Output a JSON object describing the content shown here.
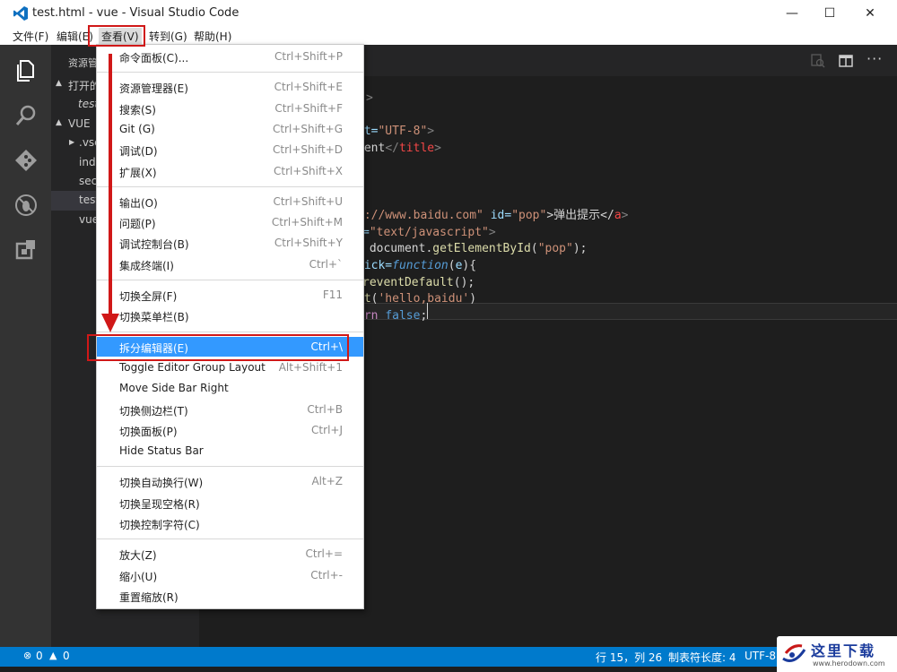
{
  "window": {
    "title": "test.html - vue - Visual Studio Code",
    "minimize": "—",
    "maximize": "☐",
    "close": "✕"
  },
  "menubar": {
    "items": [
      "文件(F)",
      "编辑(E)",
      "查看(V)",
      "转到(G)",
      "帮助(H)"
    ]
  },
  "sidebar": {
    "header": "资源管",
    "sections": [
      {
        "label": "打开的",
        "arrow": "▲"
      },
      {
        "label": "VUE",
        "arrow": "▲"
      }
    ],
    "open_file": "test",
    "files": [
      {
        "name": ".vsc",
        "arrow": "▶"
      },
      {
        "name": "inde"
      },
      {
        "name": "sect"
      },
      {
        "name": "test"
      },
      {
        "name": "vue"
      }
    ]
  },
  "code_lines": [
    {
      "parts": [
        {
          "t": ">",
          "c": "#808080"
        }
      ]
    },
    {
      "parts": []
    },
    {
      "parts": [
        {
          "t": "et=",
          "c": "#9cdcfe"
        },
        {
          "t": "\"UTF-8\"",
          "c": "#ce9178"
        },
        {
          "t": ">",
          "c": "#808080"
        }
      ]
    },
    {
      "parts": [
        {
          "t": "ment",
          "c": "#d4d4d4"
        },
        {
          "t": "</",
          "c": "#808080"
        },
        {
          "t": "title",
          "c": "#f44747"
        },
        {
          "t": ">",
          "c": "#808080"
        }
      ]
    },
    {
      "parts": []
    },
    {
      "parts": []
    },
    {
      "parts": []
    },
    {
      "parts": [
        {
          "t": "p://www.baidu.com\"",
          "c": "#ce9178"
        },
        {
          "t": " id=",
          "c": "#9cdcfe"
        },
        {
          "t": "\"pop\"",
          "c": "#ce9178"
        },
        {
          "t": ">弹出提示</",
          "c": "#d4d4d4"
        },
        {
          "t": "a",
          "c": "#f44747"
        },
        {
          "t": ">",
          "c": "#808080"
        }
      ]
    },
    {
      "parts": [
        {
          "t": "=",
          "c": "#9cdcfe"
        },
        {
          "t": "\"text/javascript\"",
          "c": "#ce9178"
        },
        {
          "t": ">",
          "c": "#808080"
        }
      ]
    },
    {
      "parts": [
        {
          "t": " document.",
          "c": "#d4d4d4"
        },
        {
          "t": "getElementById",
          "c": "#dcdcaa"
        },
        {
          "t": "(",
          "c": "#d4d4d4"
        },
        {
          "t": "\"pop\"",
          "c": "#ce9178"
        },
        {
          "t": ");",
          "c": "#d4d4d4"
        }
      ]
    },
    {
      "parts": [
        {
          "t": "lick=",
          "c": "#9cdcfe"
        },
        {
          "t": "function",
          "c": "#569cd6"
        },
        {
          "t": "(",
          "c": "#d4d4d4"
        },
        {
          "t": "e",
          "c": "#9cdcfe"
        },
        {
          "t": "){",
          "c": "#d4d4d4"
        }
      ]
    },
    {
      "parts": [
        {
          "t": "reventDefault",
          "c": "#dcdcaa"
        },
        {
          "t": "();",
          "c": "#d4d4d4"
        }
      ]
    },
    {
      "parts": [
        {
          "t": "rt",
          "c": "#dcdcaa"
        },
        {
          "t": "(",
          "c": "#d4d4d4"
        },
        {
          "t": "'hello,baidu'",
          "c": "#ce9178"
        },
        {
          "t": ")",
          "c": "#d4d4d4"
        }
      ]
    },
    {
      "parts": [
        {
          "t": "urn ",
          "c": "#c586c0"
        },
        {
          "t": "false",
          "c": "#569cd6"
        },
        {
          "t": ";",
          "c": "#d4d4d4"
        }
      ]
    }
  ],
  "view_menu": {
    "groups": [
      [
        {
          "label": "命令面板(C)...",
          "key": "Ctrl+Shift+P"
        }
      ],
      [
        {
          "label": "资源管理器(E)",
          "key": "Ctrl+Shift+E"
        },
        {
          "label": "搜索(S)",
          "key": "Ctrl+Shift+F"
        },
        {
          "label": "Git (G)",
          "key": "Ctrl+Shift+G"
        },
        {
          "label": "调试(D)",
          "key": "Ctrl+Shift+D"
        },
        {
          "label": "扩展(X)",
          "key": "Ctrl+Shift+X"
        }
      ],
      [
        {
          "label": "输出(O)",
          "key": "Ctrl+Shift+U"
        },
        {
          "label": "问题(P)",
          "key": "Ctrl+Shift+M"
        },
        {
          "label": "调试控制台(B)",
          "key": "Ctrl+Shift+Y"
        },
        {
          "label": "集成终端(I)",
          "key": "Ctrl+`"
        }
      ],
      [
        {
          "label": "切换全屏(F)",
          "key": "F11"
        },
        {
          "label": "切换菜单栏(B)",
          "key": ""
        }
      ],
      [
        {
          "label": "拆分编辑器(E)",
          "key": "Ctrl+\\",
          "highlighted": true
        },
        {
          "label": "Toggle Editor Group Layout",
          "key": "Alt+Shift+1"
        },
        {
          "label": "Move Side Bar Right",
          "key": ""
        },
        {
          "label": "切换侧边栏(T)",
          "key": "Ctrl+B"
        },
        {
          "label": "切换面板(P)",
          "key": "Ctrl+J"
        },
        {
          "label": "Hide Status Bar",
          "key": ""
        }
      ],
      [
        {
          "label": "切换自动换行(W)",
          "key": "Alt+Z"
        },
        {
          "label": "切换呈现空格(R)",
          "key": ""
        },
        {
          "label": "切换控制字符(C)",
          "key": ""
        }
      ],
      [
        {
          "label": "放大(Z)",
          "key": "Ctrl+="
        },
        {
          "label": "缩小(U)",
          "key": "Ctrl+-"
        },
        {
          "label": "重置缩放(R)",
          "key": ""
        }
      ]
    ]
  },
  "statusbar": {
    "errors": "0",
    "warnings": "0",
    "position": "行 15，列 26",
    "tab_size": "制表符长度: 4",
    "encoding": "UTF-8"
  },
  "watermark": {
    "brand": "这里下载",
    "url": "www.herodown.com"
  },
  "colors": {
    "statusbar": "#007acc",
    "menu_highlight": "#3399ff",
    "annotation": "#d01818",
    "activity_bar": "#333333",
    "sidebar": "#252526",
    "editor": "#1e1e1e"
  }
}
